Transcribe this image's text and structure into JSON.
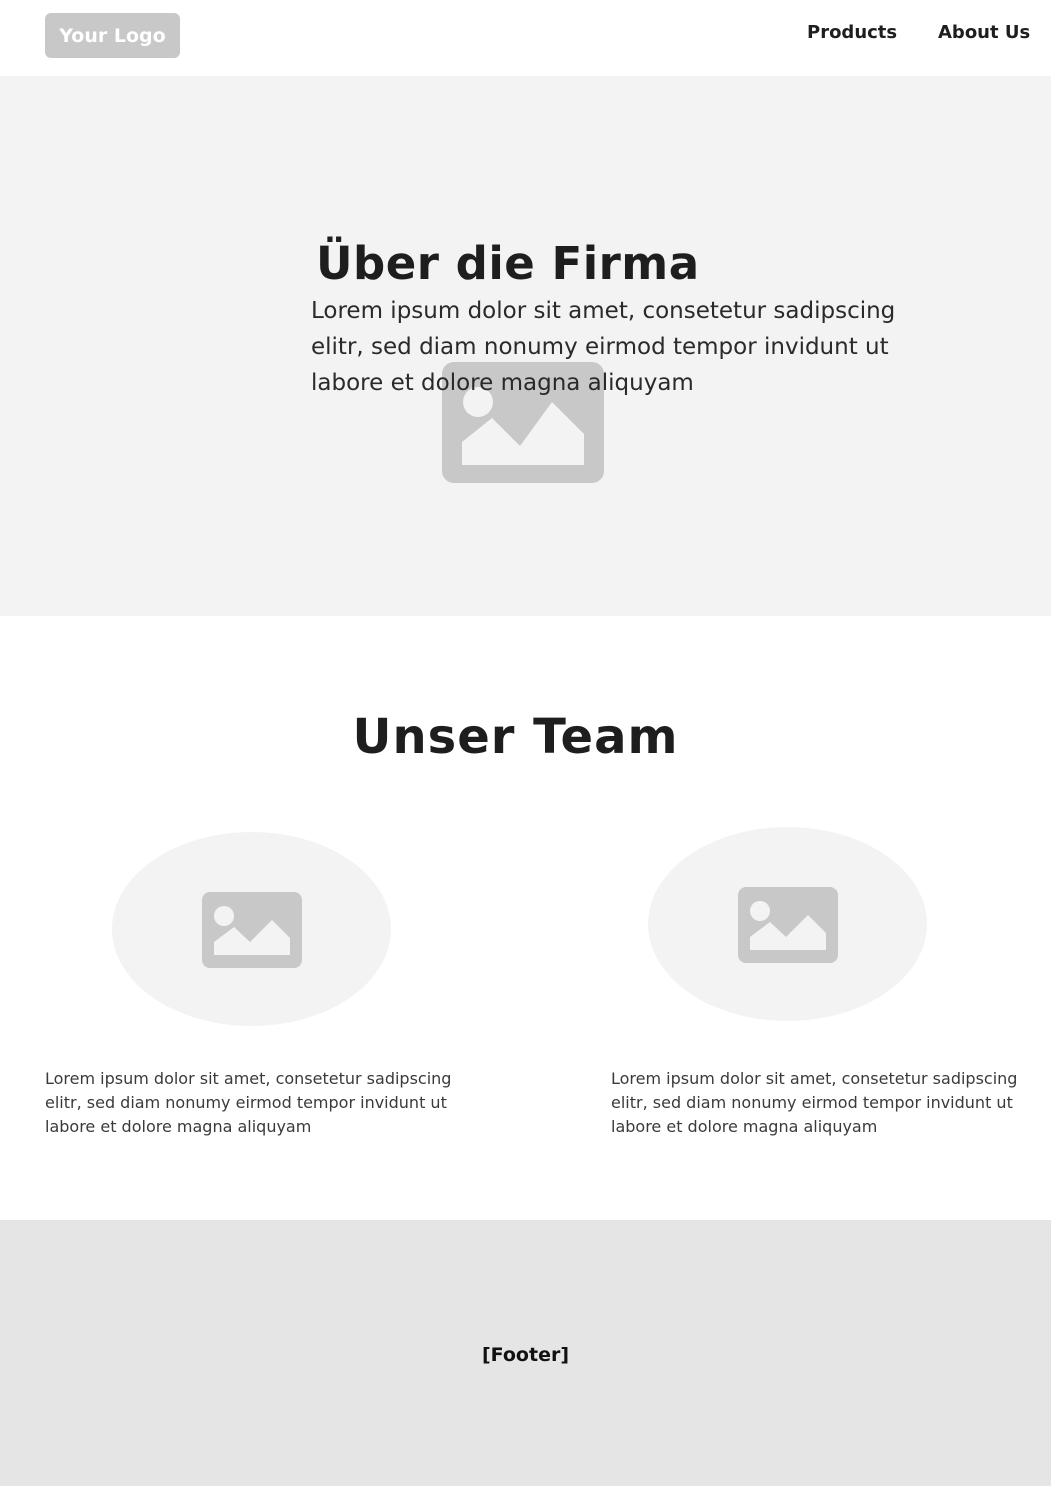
{
  "header": {
    "logo_text": "Your Logo",
    "nav": [
      {
        "label": "Products"
      },
      {
        "label": "About Us"
      }
    ]
  },
  "hero": {
    "title": "Über die Firma",
    "text": "Lorem ipsum dolor sit amet, consetetur sadipscing elitr, sed diam nonumy eirmod tempor invidunt ut labore et dolore magna aliquyam",
    "image_icon": "image-placeholder-icon"
  },
  "team": {
    "title": "Unser Team",
    "members": [
      {
        "text": "Lorem ipsum dolor sit amet, consetetur sadipscing elitr, sed diam nonumy eirmod tempor invidunt ut labore et dolore magna aliquyam",
        "image_icon": "image-placeholder-icon"
      },
      {
        "text": "Lorem ipsum dolor sit amet, consetetur sadipscing elitr, sed diam nonumy eirmod tempor invidunt ut labore et dolore magna aliquyam",
        "image_icon": "image-placeholder-icon"
      }
    ]
  },
  "footer": {
    "label": "[Footer]"
  },
  "colors": {
    "placeholder_gray": "#c8c8c8",
    "hero_bg": "#f3f3f3",
    "footer_bg": "#e5e5e5",
    "text": "#1e1e1e"
  }
}
